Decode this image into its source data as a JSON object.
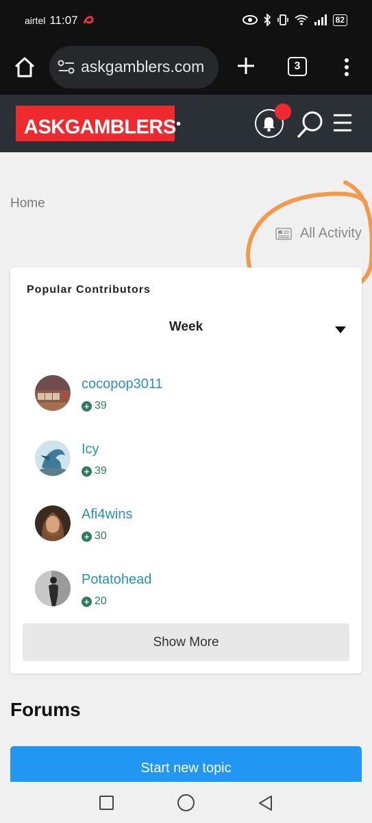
{
  "status_bar": {
    "carrier": "airtel",
    "time": "11:07",
    "battery": "82"
  },
  "browser": {
    "url": "askgamblers.com",
    "tab_count": "3"
  },
  "site": {
    "logo_text": "ASKGAMBLERS",
    "brand_color": "#ee2a2f"
  },
  "breadcrumb": {
    "home": "Home"
  },
  "activity_link": {
    "label": "All Activity"
  },
  "popular_contributors": {
    "title": "Popular Contributors",
    "period": "Week",
    "contributors": [
      {
        "name": "cocopop3011",
        "reputation": "39"
      },
      {
        "name": "Icy",
        "reputation": "39"
      },
      {
        "name": "Afi4wins",
        "reputation": "30"
      },
      {
        "name": "Potatohead",
        "reputation": "20"
      }
    ],
    "show_more_label": "Show More"
  },
  "forums": {
    "heading": "Forums",
    "new_topic_label": "Start new topic"
  },
  "colors": {
    "username": "#2b8fbf",
    "reputation": "#2e7d5b",
    "primary_button": "#2196f3",
    "annotation": "#f2994a"
  }
}
